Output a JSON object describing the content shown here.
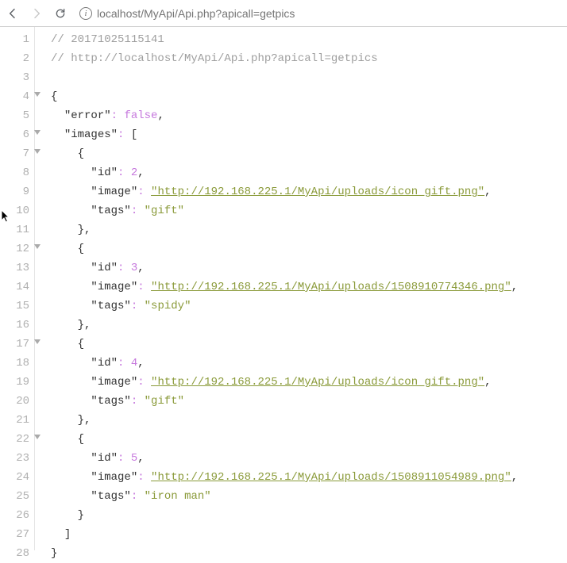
{
  "browser": {
    "url": "localhost/MyApi/Api.php?apicall=getpics"
  },
  "code": {
    "comment_top": "// 20171025115141",
    "comment_url": "// http://localhost/MyApi/Api.php?apicall=getpics",
    "open_brace": "{",
    "error_key": "\"error\"",
    "error_val": "false",
    "images_key": "\"images\"",
    "open_bracket": "[",
    "obj_open": "{",
    "obj_close_comma": "},",
    "obj_close": "}",
    "close_bracket": "]",
    "id_key": "\"id\"",
    "image_key": "\"image\"",
    "tags_key": "\"tags\"",
    "items": [
      {
        "id": "2",
        "image": "\"http://192.168.225.1/MyApi/uploads/icon_gift.png\"",
        "tags": "\"gift\""
      },
      {
        "id": "3",
        "image": "\"http://192.168.225.1/MyApi/uploads/1508910774346.png\"",
        "tags": "\"spidy\""
      },
      {
        "id": "4",
        "image": "\"http://192.168.225.1/MyApi/uploads/icon_gift.png\"",
        "tags": "\"gift\""
      },
      {
        "id": "5",
        "image": "\"http://192.168.225.1/MyApi/uploads/1508911054989.png\"",
        "tags": "\"iron man\""
      }
    ],
    "lines": [
      "1",
      "2",
      "3",
      "4",
      "5",
      "6",
      "7",
      "8",
      "9",
      "10",
      "11",
      "12",
      "13",
      "14",
      "15",
      "16",
      "17",
      "18",
      "19",
      "20",
      "21",
      "22",
      "23",
      "24",
      "25",
      "26",
      "27",
      "28"
    ]
  }
}
